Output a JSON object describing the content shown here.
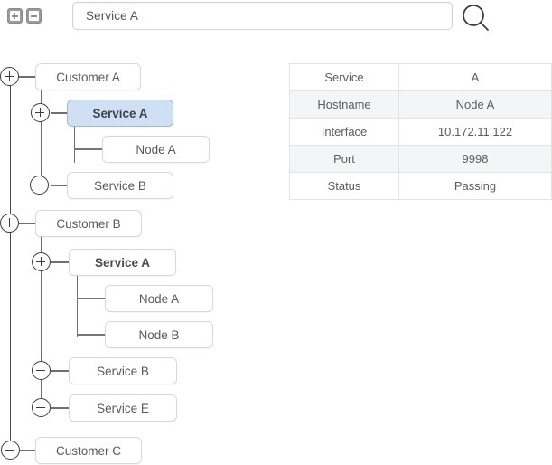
{
  "toolbar": {
    "expand_all_label": "expand-all",
    "collapse_all_label": "collapse-all"
  },
  "search": {
    "value": "Service A",
    "placeholder": "Search",
    "icon": "search-icon"
  },
  "tree": {
    "nodes": [
      {
        "id": "customer-a",
        "label": "Customer A",
        "toggle": "+",
        "level": "customer"
      },
      {
        "id": "customer-a-service-a",
        "label": "Service A",
        "toggle": "+",
        "level": "service",
        "selected": true,
        "bold": true
      },
      {
        "id": "customer-a-service-a-node-a",
        "label": "Node A",
        "level": "node"
      },
      {
        "id": "customer-a-service-b",
        "label": "Service B",
        "toggle": "-",
        "level": "service"
      },
      {
        "id": "customer-b",
        "label": "Customer B",
        "toggle": "+",
        "level": "customer"
      },
      {
        "id": "customer-b-service-a",
        "label": "Service A",
        "toggle": "+",
        "level": "service",
        "bold": true
      },
      {
        "id": "customer-b-service-a-node-a",
        "label": "Node A",
        "level": "node"
      },
      {
        "id": "customer-b-service-a-node-b",
        "label": "Node B",
        "level": "node"
      },
      {
        "id": "customer-b-service-b",
        "label": "Service B",
        "toggle": "-",
        "level": "service"
      },
      {
        "id": "customer-b-service-e",
        "label": "Service E",
        "toggle": "-",
        "level": "service"
      },
      {
        "id": "customer-c",
        "label": "Customer C",
        "toggle": "-",
        "level": "customer"
      }
    ]
  },
  "details_table": {
    "rows": [
      {
        "key": "Service",
        "value": "A"
      },
      {
        "key": "Hostname",
        "value": "Node A"
      },
      {
        "key": "Interface",
        "value": "10.172.11.122"
      },
      {
        "key": "Port",
        "value": "9998"
      },
      {
        "key": "Status",
        "value": "Passing"
      }
    ]
  },
  "colors": {
    "selected_node_bg": "#cfe0f3",
    "selected_node_border": "#9dbbd8",
    "node_border": "#d8d8d8",
    "connector": "#6f6f6f",
    "table_alt_row": "#f4f5f6",
    "text": "#5a5a5a"
  }
}
